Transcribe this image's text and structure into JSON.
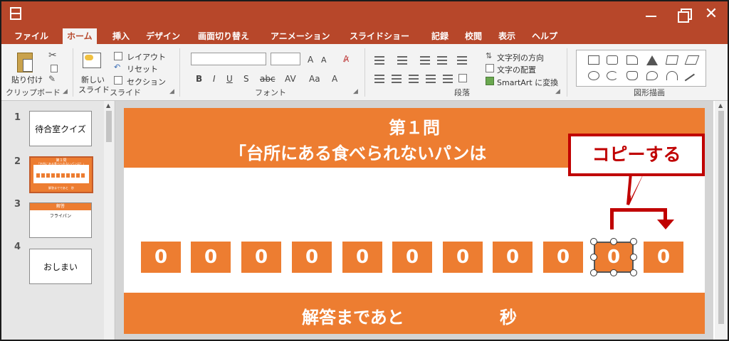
{
  "tabs": [
    "ファイル",
    "ホーム",
    "挿入",
    "デザイン",
    "画面切り替え",
    "アニメーション",
    "スライドショー",
    "記録",
    "校閲",
    "表示",
    "ヘルプ"
  ],
  "window": {
    "close_glyph": "✕"
  },
  "ribbon": {
    "paste_label": "貼り付け",
    "clipboard_label": "クリップボード",
    "new_slide_label_1": "新しい",
    "new_slide_label_2": "スライド",
    "slides_label": "スライド",
    "layout_label": "レイアウト",
    "reset_label": "リセット",
    "section_label": "セクション",
    "font_label": "フォント",
    "paragraph_label": "段落",
    "text_direction_label": "文字列の方向",
    "align_text_label": "文字の配置",
    "smartart_label": "SmartArt に変換",
    "drawing_label": "図形描画",
    "font_buttons": [
      "B",
      "I",
      "U",
      "S",
      "abc",
      "AV"
    ],
    "grow_font": "A",
    "shrink_font": "A"
  },
  "slides": [
    {
      "num": "1",
      "text": "待合室クイズ"
    },
    {
      "num": "2",
      "text": ""
    },
    {
      "num": "3",
      "text": "フライパン",
      "header": "解答"
    },
    {
      "num": "4",
      "text": "おしまい"
    }
  ],
  "thumb2": {
    "title": "第１問",
    "subtitle": "「台所にある食べられないパンは？」",
    "footer": "解答までであと　秒"
  },
  "slide": {
    "title_line1": "第１問",
    "title_line2": "「台所にある食べられないパンは",
    "bottom_left": "解答まであと",
    "bottom_right": "秒",
    "digits": [
      "0",
      "0",
      "0",
      "0",
      "0",
      "0",
      "0",
      "0",
      "0",
      "0",
      "0"
    ]
  },
  "callout_text": "コピーする",
  "colors": {
    "accent": "#b7472a",
    "slide_orange": "#ed7d31",
    "callout_red": "#c00000"
  }
}
